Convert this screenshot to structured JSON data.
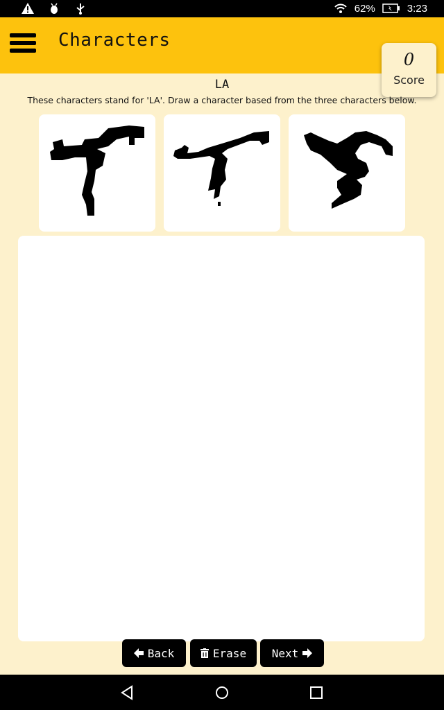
{
  "status_bar": {
    "battery": "62%",
    "time": "3:23",
    "icons": [
      "alert-icon",
      "debug-icon",
      "usb-icon",
      "wifi-icon",
      "battery-icon"
    ]
  },
  "app_bar": {
    "title": "Characters",
    "menu_icon": "hamburger-menu-icon"
  },
  "score": {
    "value": "0",
    "label": "Score"
  },
  "content": {
    "character": "LA",
    "instructions": "These characters stand for 'LA'. Draw a character based from the three characters below."
  },
  "buttons": {
    "back": "Back",
    "erase": "Erase",
    "next": "Next"
  },
  "nav_bar": {
    "icons": [
      "back-triangle-icon",
      "home-circle-icon",
      "recents-square-icon"
    ]
  },
  "colors": {
    "app_bar": "#fdc20d",
    "background": "#fdf1cc",
    "button": "#000000"
  }
}
